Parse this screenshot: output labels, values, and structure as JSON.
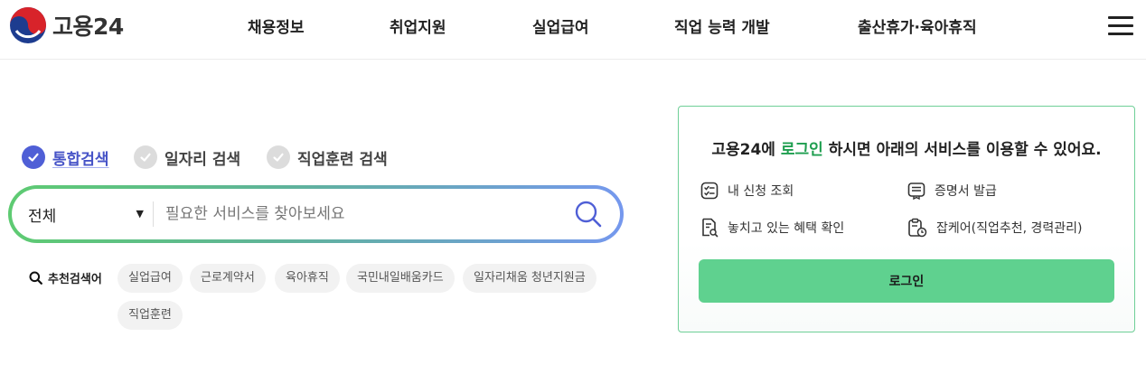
{
  "header": {
    "logo_text": "고용24",
    "nav": [
      "채용정보",
      "취업지원",
      "실업급여",
      "직업 능력 개발",
      "출산휴가·육아휴직"
    ]
  },
  "search": {
    "tabs": [
      {
        "label": "통합검색",
        "active": true
      },
      {
        "label": "일자리 검색",
        "active": false
      },
      {
        "label": "직업훈련 검색",
        "active": false
      }
    ],
    "scope_value": "전체",
    "placeholder": "필요한 서비스를 찾아보세요",
    "recommended_label": "추천검색어",
    "keywords": [
      "실업급여",
      "근로계약서",
      "육아휴직",
      "국민내일배움카드",
      "일자리채움 청년지원금",
      "직업훈련"
    ]
  },
  "login_box": {
    "title_prefix": "고용24에 ",
    "title_highlight": "로그인",
    "title_suffix": " 하시면 아래의 서비스를 이용할 수 있어요.",
    "services": [
      {
        "label": "내 신청 조회",
        "icon": "checklist-icon"
      },
      {
        "label": "증명서 발급",
        "icon": "certificate-icon"
      },
      {
        "label": "놓치고 있는 혜택 확인",
        "icon": "document-search-icon"
      },
      {
        "label": "잡케어(직업추천, 경력관리)",
        "icon": "clipboard-clock-icon"
      }
    ],
    "button_label": "로그인"
  },
  "colors": {
    "accent_blue": "#4f5fd6",
    "accent_green": "#1e9e4f",
    "login_button": "#5fd18f"
  }
}
